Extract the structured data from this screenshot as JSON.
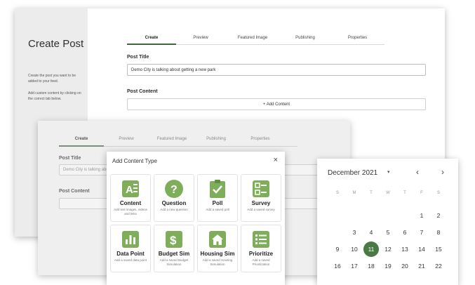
{
  "back": {
    "side_title": "Create Post",
    "side_desc_1": "Create the post you want to be added to your feed.",
    "side_desc_2": "Add custom content by clicking on the correct tab below.",
    "tabs": [
      "Create",
      "Preview",
      "Featured Image",
      "Publishing",
      "Properties"
    ],
    "post_title_label": "Post Title",
    "post_title_value": "Demo City is talking about getting a new park",
    "post_content_label": "Post Content",
    "add_content_label": "+ Add Content"
  },
  "mid": {
    "tabs": [
      "Create",
      "Preview",
      "Featured Image",
      "Publishing",
      "Properties"
    ],
    "post_title_label": "Post Title",
    "post_title_value": "Demo City is talking about",
    "post_content_label": "Post Content"
  },
  "modal": {
    "title": "Add Content Type",
    "close": "×",
    "cards": [
      {
        "name": "Content",
        "desc": "Add text images, videos and links",
        "icon": "text-image-icon"
      },
      {
        "name": "Question",
        "desc": "Add a new question",
        "icon": "question-icon"
      },
      {
        "name": "Poll",
        "desc": "Add a saved poll",
        "icon": "clipboard-check-icon"
      },
      {
        "name": "Survey",
        "desc": "Add a saved survey",
        "icon": "checklist-icon"
      },
      {
        "name": "Data Point",
        "desc": "Add a saved data point",
        "icon": "bar-chart-icon"
      },
      {
        "name": "Budget Sim",
        "desc": "Add a saved Budget Simulation",
        "icon": "dollar-icon"
      },
      {
        "name": "Housing Sim",
        "desc": "Add a saved Housing Simulation",
        "icon": "house-icon"
      },
      {
        "name": "Prioritize",
        "desc": "Add a saved Prioritization",
        "icon": "list-icon"
      }
    ]
  },
  "calendar": {
    "month": "December 2021",
    "dropdown": "▾",
    "prev": "‹",
    "next": "›",
    "weekdays": [
      "S",
      "M",
      "T",
      "W",
      "T",
      "F",
      "S"
    ],
    "selected_day": 11,
    "accent": "#4a7a44",
    "weeks": [
      [
        "",
        "",
        "",
        "",
        "",
        "1",
        "2"
      ],
      [
        "",
        "3",
        "4",
        "5",
        "6",
        "7",
        "8"
      ],
      [
        "9",
        "10",
        "11",
        "12",
        "13",
        "14",
        "15"
      ],
      [
        "16",
        "17",
        "18",
        "19",
        "20",
        "21",
        "22"
      ]
    ]
  }
}
